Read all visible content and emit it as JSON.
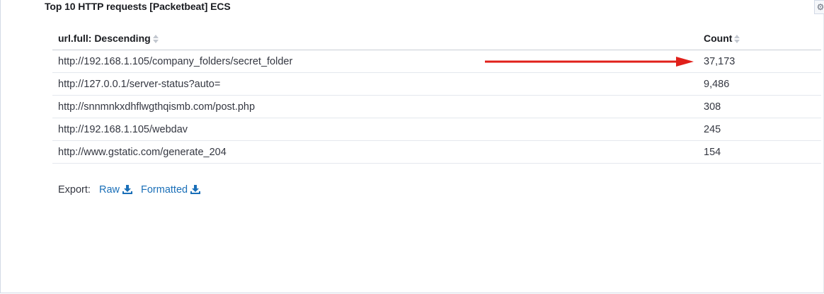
{
  "panel": {
    "title": "Top 10 HTTP requests [Packetbeat] ECS",
    "options_icon": "gear-icon"
  },
  "table": {
    "columns": [
      {
        "label": "url.full: Descending",
        "sort_icon": "sort-icon"
      },
      {
        "label": "Count",
        "sort_icon": "sort-icon"
      }
    ],
    "rows": [
      {
        "url": "http://192.168.1.105/company_folders/secret_folder",
        "count": "37,173"
      },
      {
        "url": "http://127.0.0.1/server-status?auto=",
        "count": "9,486"
      },
      {
        "url": "http://snnmnkxdhflwgthqismb.com/post.php",
        "count": "308"
      },
      {
        "url": "http://192.168.1.105/webdav",
        "count": "245"
      },
      {
        "url": "http://www.gstatic.com/generate_204",
        "count": "154"
      }
    ]
  },
  "export": {
    "label": "Export:",
    "raw_label": "Raw",
    "formatted_label": "Formatted",
    "icon": "download-icon"
  },
  "annotation": {
    "icon": "red-arrow-icon",
    "color": "#e0201a"
  },
  "colors": {
    "link": "#1a6fb8",
    "arrow": "#e0201a"
  }
}
